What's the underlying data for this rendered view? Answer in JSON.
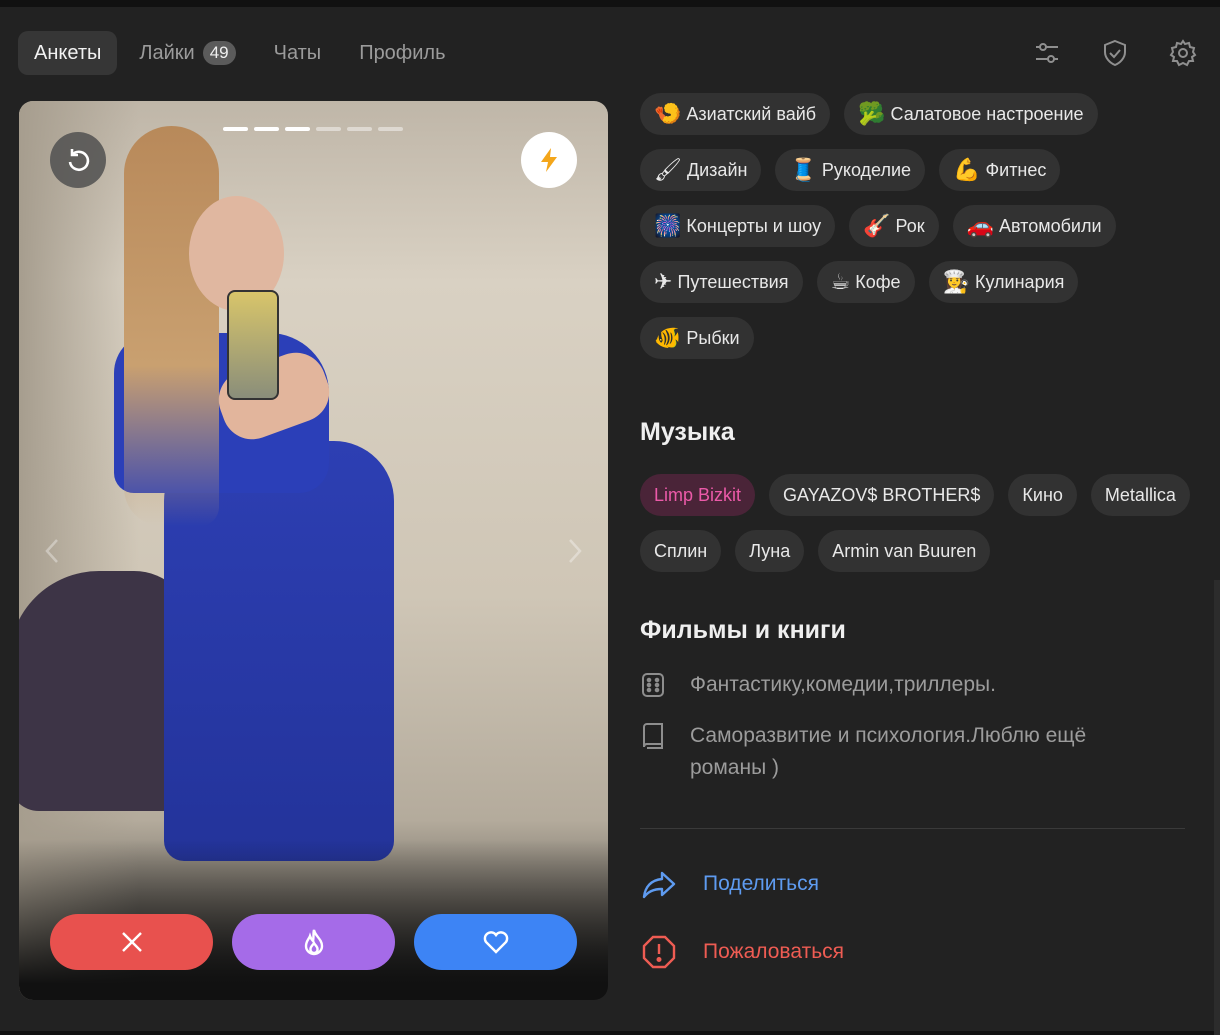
{
  "nav": {
    "tabs": [
      {
        "label": "Анкеты"
      },
      {
        "label": "Лайки",
        "badge": "49"
      },
      {
        "label": "Чаты"
      },
      {
        "label": "Профиль"
      }
    ],
    "icons": [
      "filters-icon",
      "shield-check-icon",
      "gear-icon"
    ]
  },
  "card": {
    "photo_count": 6,
    "current_photo": 3,
    "buttons": [
      "undo-icon",
      "lightning-icon",
      "chevron-left-icon",
      "chevron-right-icon"
    ],
    "actions": [
      "close-icon",
      "fire-icon",
      "heart-icon"
    ],
    "colors": {
      "dislike": "#e8514e",
      "superlike": "#a56be8",
      "like": "#3d84f5",
      "boost": "#f4a61a"
    }
  },
  "interests": [
    {
      "emoji": "🍤",
      "label": "Азиатский вайб"
    },
    {
      "emoji": "🥦",
      "label": "Салатовое настроение"
    },
    {
      "emoji": "🖌",
      "label": "Дизайн"
    },
    {
      "emoji": "🧵",
      "label": "Рукоделие"
    },
    {
      "emoji": "💪",
      "label": "Фитнес"
    },
    {
      "emoji": "🎆",
      "label": "Концерты и шоу"
    },
    {
      "emoji": "🎸",
      "label": "Рок"
    },
    {
      "emoji": "🚗",
      "label": "Автомобили"
    },
    {
      "emoji": "✈",
      "label": "Путешествия"
    },
    {
      "emoji": "☕",
      "label": "Кофе"
    },
    {
      "emoji": "👩‍🍳",
      "label": "Кулинария"
    },
    {
      "emoji": "🐠",
      "label": "Рыбки"
    }
  ],
  "music": {
    "title": "Музыка",
    "items": [
      "Limp Bizkit",
      "GAYAZOV$ BROTHER$",
      "Кино",
      "Metallica",
      "Сплин",
      "Луна",
      "Armin van Buuren"
    ],
    "highlighted": "Limp Bizkit",
    "highlight_color": "#ec5aa9"
  },
  "films_books": {
    "title": "Фильмы и книги",
    "films": "Фантастику,комедии,триллеры.",
    "books": "Саморазвитие и психология.Люблю ещё романы )"
  },
  "links": {
    "share": "Поделиться",
    "report": "Пожаловаться",
    "share_color": "#5e9bf0",
    "report_color": "#ee5c53"
  }
}
